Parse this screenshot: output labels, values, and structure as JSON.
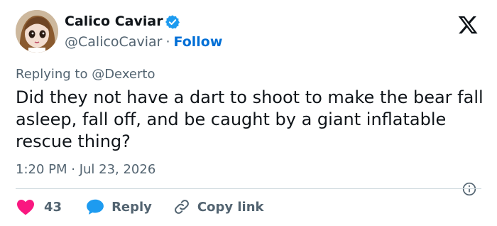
{
  "tweet": {
    "author": "Calico Caviar",
    "handle": "@CalicoCaviar",
    "separator": "·",
    "follow_label": "Follow",
    "replying_to": "Replying to @Dexerto",
    "text": "Did they not have a dart to shoot to make the bear fall asleep, fall off, and be caught by a giant inflatable rescue thing?",
    "timestamp": "1:20 PM · Jul 23, 2026"
  },
  "actions": {
    "like_count": "43",
    "reply_label": "Reply",
    "copy_link_label": "Copy link"
  },
  "colors": {
    "text": "#0f1419",
    "muted": "#536471",
    "link": "#006fd6",
    "heart": "#f91880",
    "reply": "#1d9bf0",
    "divider": "#cfd9de"
  },
  "icons": [
    "avatar",
    "verified-badge-icon",
    "x-logo-icon",
    "info-icon",
    "heart-icon",
    "reply-bubble-icon",
    "link-icon"
  ]
}
